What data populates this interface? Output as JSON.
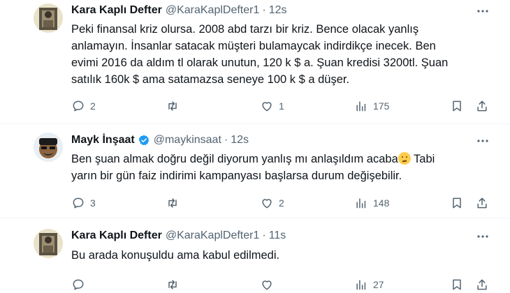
{
  "tweets": [
    {
      "name": "Kara Kaplı Defter",
      "handle": "@KaraKaplDefter1",
      "time": "12s",
      "text": "Peki finansal kriz olursa. 2008 abd tarzı bir kriz. Bence olacak yanlış\nanlamayın. İnsanlar satacak müşteri bulamaycak indirdikçe inecek. Ben\nevimi 2016 da aldım tl olarak unutun, 120 k $ a. Şuan kredisi 3200tl. Şuan\nsatılık 160k $ ama satamazsa seneye 100 k $ a düşer.",
      "replies": "2",
      "retweets": "",
      "likes": "1",
      "views": "175"
    },
    {
      "name": "Mayk İnşaat",
      "handle": "@maykinsaat",
      "time": "12s",
      "text_line1": "Ben şuan almak doğru değil diyorum yanlış mı anlaşıldım acaba",
      "emoji": "thinking-face",
      "text_line1_tail": " Tabi",
      "text_line2": "yarın bir gün faiz indirimi kampanyası başlarsa durum değişebilir.",
      "replies": "3",
      "retweets": "",
      "likes": "2",
      "views": "148"
    },
    {
      "name": "Kara Kaplı Defter",
      "handle": "@KaraKaplDefter1",
      "time": "11s",
      "text": "Bu arada konuşuldu ama kabul edilmedi.",
      "replies": "",
      "retweets": "",
      "likes": "",
      "views": "27"
    }
  ],
  "colors": {
    "text": "#0f1419",
    "muted": "#536471",
    "verified": "#1d9bf0",
    "separator": "#eff3f4"
  }
}
